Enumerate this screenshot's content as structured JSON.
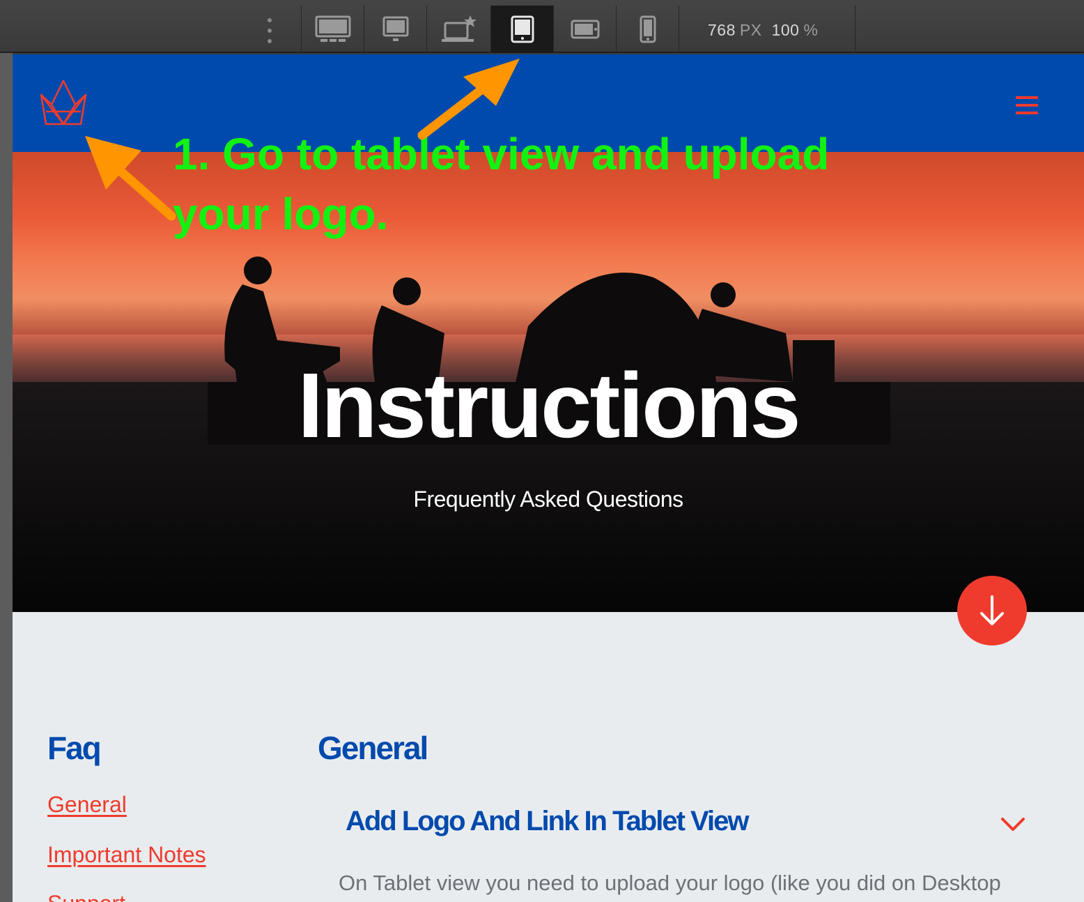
{
  "toolbar": {
    "devices": [
      {
        "name": "desktop-wide",
        "active": false
      },
      {
        "name": "desktop",
        "active": false
      },
      {
        "name": "laptop-primary",
        "active": false
      },
      {
        "name": "tablet-portrait",
        "active": true
      },
      {
        "name": "tablet-landscape",
        "active": false
      },
      {
        "name": "mobile",
        "active": false
      }
    ],
    "width_value": "768",
    "width_unit": "PX",
    "zoom_value": "100",
    "zoom_unit": "%"
  },
  "site": {
    "colors": {
      "brand_blue": "#004aad",
      "accent_red": "#ef3b2d",
      "annotation_green": "#12f212",
      "arrow_orange": "#ff9500"
    },
    "hero": {
      "title": "Instructions",
      "subtitle": "Frequently Asked Questions"
    },
    "sidebar": {
      "heading": "Faq",
      "links": [
        "General",
        "Important Notes",
        "Support"
      ]
    },
    "main": {
      "section_title": "General",
      "question": "Add Logo And Link In Tablet View",
      "answer": "On Tablet view you need to upload your logo (like you did on Desktop view) and add a custom link."
    }
  },
  "annotation": {
    "line1": "1. Go to tablet view and upload",
    "line2": "your logo."
  }
}
